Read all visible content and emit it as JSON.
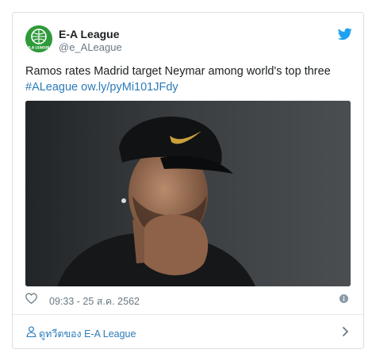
{
  "tweet": {
    "author": {
      "name": "E-A League",
      "handle": "@e_ALeague",
      "avatar_text": "E.A LEAGUE"
    },
    "text": "Ramos rates Madrid target Neymar among world's top three",
    "hashtag": "#ALeague",
    "link": "ow.ly/pyMi101JFdy",
    "timestamp": "09:33 - 25 ส.ค. 2562",
    "footer_label": "ดูทวีตของ E-A League"
  },
  "colors": {
    "link": "#2b7bb9",
    "twitter_blue": "#1da1f2",
    "avatar_green": "#2f9a3a",
    "muted": "#697882"
  },
  "icons": [
    "e-a-league-logo-icon",
    "twitter-bird-icon",
    "heart-icon",
    "info-icon",
    "person-icon",
    "chevron-right-icon"
  ]
}
